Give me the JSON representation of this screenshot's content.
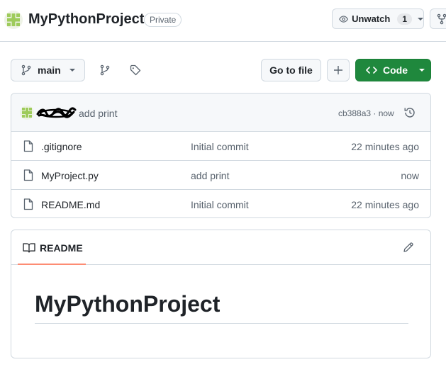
{
  "repo": {
    "name": "MyPythonProject",
    "visibility": "Private"
  },
  "watch": {
    "label": "Unwatch",
    "count": "1"
  },
  "toolbar": {
    "branch": "main",
    "go_to_file": "Go to file",
    "code_label": "Code"
  },
  "commit": {
    "message": "add print",
    "meta": "cb388a3 · now"
  },
  "files": [
    {
      "name": ".gitignore",
      "commit": "Initial commit",
      "time": "22 minutes ago"
    },
    {
      "name": "MyProject.py",
      "commit": "add print",
      "time": "now"
    },
    {
      "name": "README.md",
      "commit": "Initial commit",
      "time": "22 minutes ago"
    }
  ],
  "readme": {
    "tab_label": "README",
    "heading": "MyPythonProject"
  },
  "colors": {
    "accent_green": "#1f883d",
    "tab_underline": "#fd8c73",
    "border": "#d1d9e0"
  },
  "icons": [
    "identicon",
    "eye-icon",
    "fork-icon",
    "git-branch-icon",
    "branches-icon",
    "tag-icon",
    "plus-icon",
    "code-icon",
    "history-icon",
    "file-icon",
    "book-icon",
    "pencil-icon"
  ]
}
